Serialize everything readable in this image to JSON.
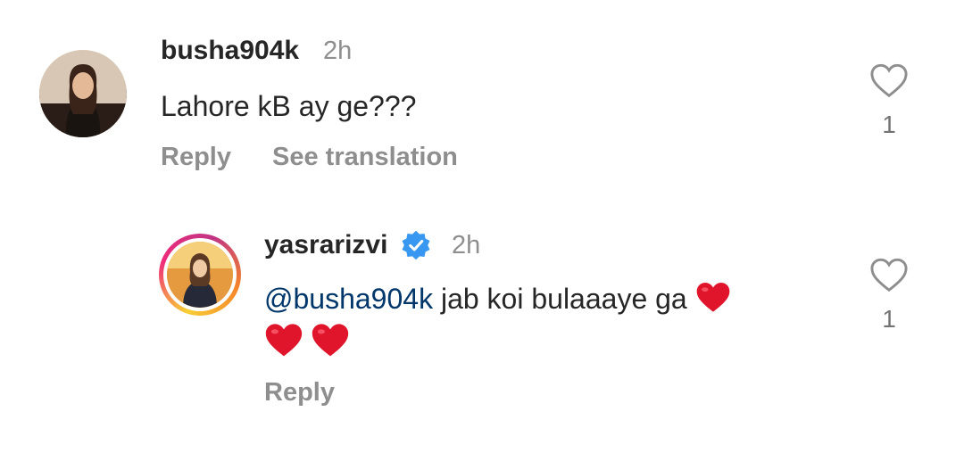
{
  "comments": [
    {
      "username": "busha904k",
      "time": "2h",
      "text": "Lahore kB ay ge???",
      "reply_label": "Reply",
      "translate_label": "See translation",
      "like_count": "1"
    },
    {
      "username": "yasrarizvi",
      "time": "2h",
      "mention": "@busha904k",
      "text": " jab koi bulaaaye ga",
      "reply_label": "Reply",
      "like_count": "1"
    }
  ],
  "icons": {
    "heart": "heart-outline-icon",
    "verified": "verified-badge-icon",
    "emoji": "red-heart-emoji"
  },
  "colors": {
    "username": "#262626",
    "muted": "#8e8e8e",
    "mention": "#00376b",
    "verified": "#3897f0",
    "emoji_heart": "#e0142a"
  }
}
